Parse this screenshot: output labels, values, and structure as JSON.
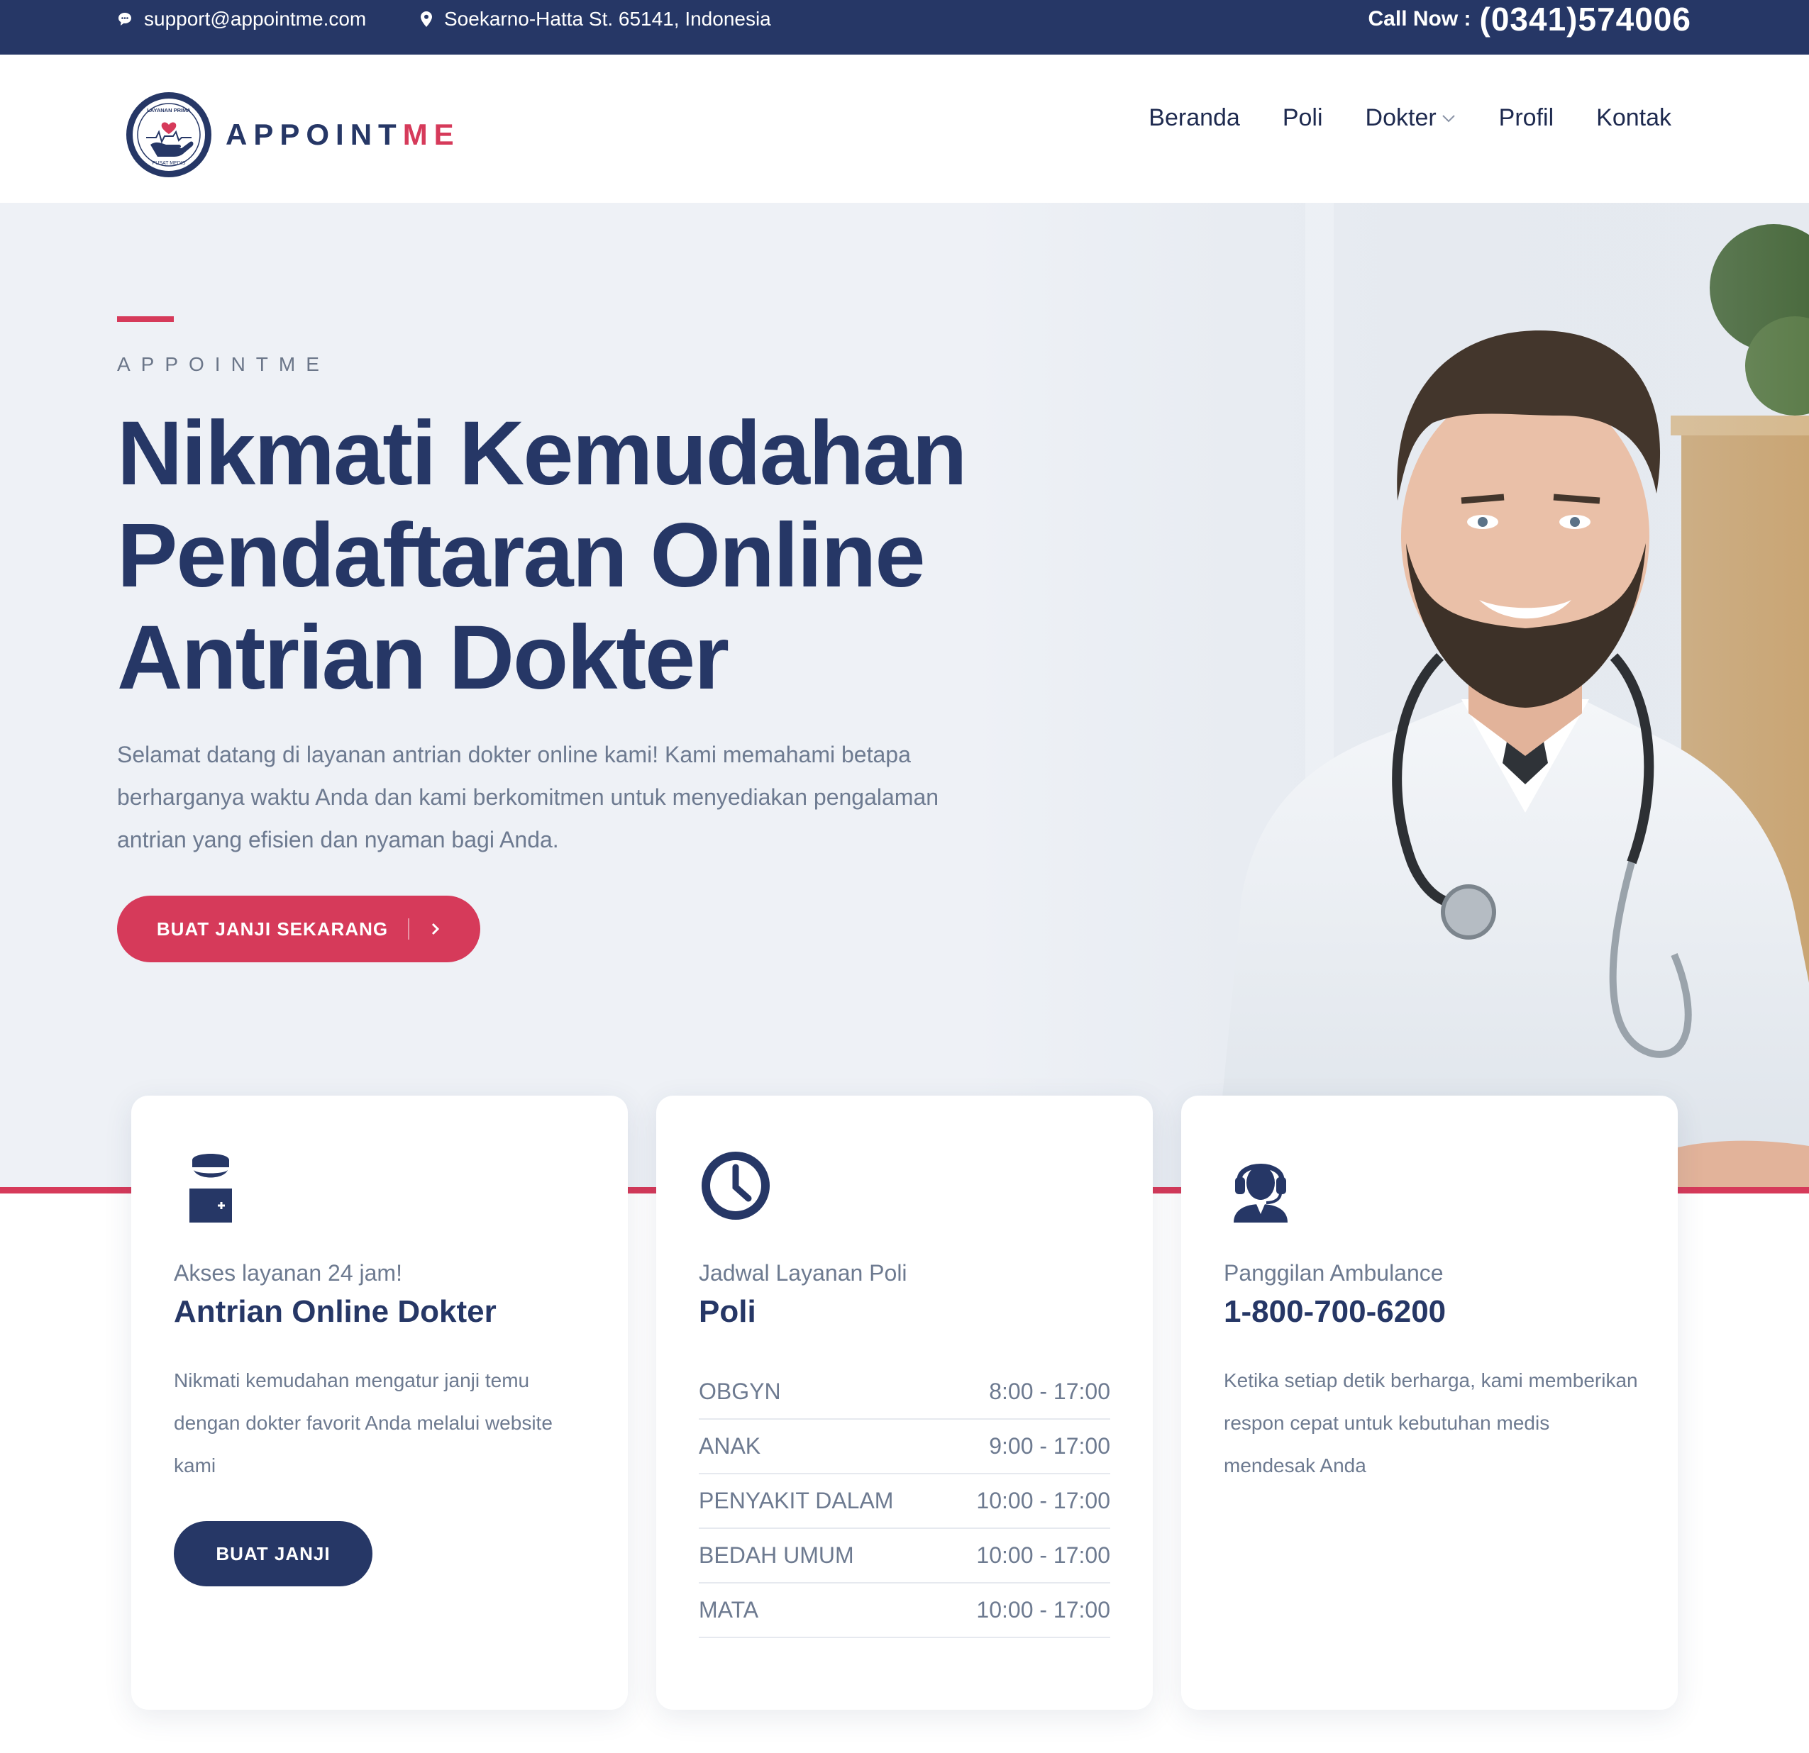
{
  "topbar": {
    "email": "support@appointme.com",
    "address": "Soekarno-Hatta St. 65141, Indonesia",
    "call_label": "Call Now :",
    "call_number": "(0341)574006"
  },
  "brand": {
    "name_main": "APPOINT",
    "name_accent": "ME",
    "emblem_top": "LAYANAN PRIMA",
    "emblem_bottom": "PUSAT MEDIS"
  },
  "nav": {
    "items": [
      {
        "label": "Beranda"
      },
      {
        "label": "Poli"
      },
      {
        "label": "Dokter"
      },
      {
        "label": "Profil"
      },
      {
        "label": "Kontak"
      }
    ]
  },
  "hero": {
    "eyebrow": "APPOINTME",
    "title_line1": "Nikmati Kemudahan",
    "title_line2": "Pendaftaran Online",
    "title_line3": "Antrian Dokter",
    "text": "Selamat datang di layanan antrian dokter online kami! Kami memahami betapa berharganya waktu Anda dan kami berkomitmen untuk menyediakan pengalaman antrian yang efisien dan nyaman bagi Anda.",
    "cta_label": "BUAT JANJI SEKARANG"
  },
  "cards": [
    {
      "icon": "doctor-icon",
      "sub": "Akses layanan 24 jam!",
      "title": "Antrian Online Dokter",
      "body": "Nikmati kemudahan mengatur janji temu dengan dokter favorit Anda melalui website kami",
      "button": "BUAT JANJI"
    },
    {
      "icon": "clock-icon",
      "sub": "Jadwal Layanan Poli",
      "title": "Poli",
      "schedule": [
        {
          "name": "OBGYN",
          "hours": "8:00 - 17:00"
        },
        {
          "name": "ANAK",
          "hours": "9:00 - 17:00"
        },
        {
          "name": "PENYAKIT DALAM",
          "hours": "10:00 - 17:00"
        },
        {
          "name": "BEDAH UMUM",
          "hours": "10:00 - 17:00"
        },
        {
          "name": "MATA",
          "hours": "10:00 - 17:00"
        }
      ]
    },
    {
      "icon": "headset-agent-icon",
      "sub": "Panggilan Ambulance",
      "title": "1-800-700-6200",
      "body": "Ketika setiap detik berharga, kami memberikan respon cepat untuk kebutuhan medis mendesak Anda"
    }
  ],
  "colors": {
    "navy": "#263766",
    "accent": "#d63a5a",
    "text_muted": "#6d7a90",
    "hero_bg": "#eef1f6"
  }
}
